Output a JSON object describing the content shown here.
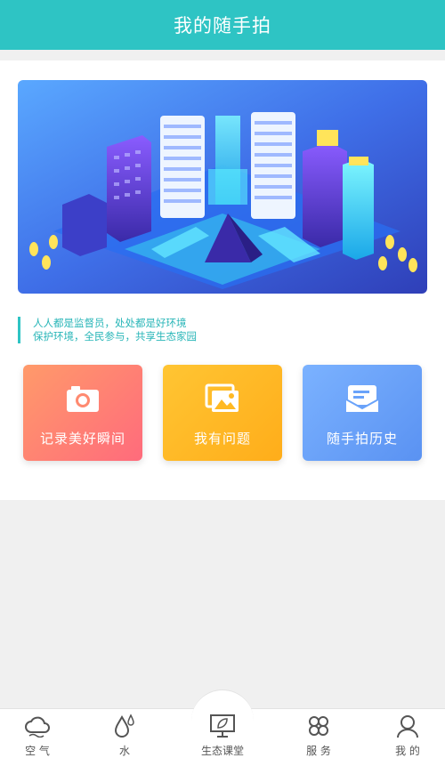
{
  "header": {
    "title": "我的随手拍"
  },
  "slogan": {
    "line1": "人人都是监督员，处处都是好环境",
    "line2": "保护环境，全民参与，共享生态家园"
  },
  "tiles": [
    {
      "label": "记录美好瞬间",
      "icon": "camera-icon",
      "color": "#ff7e74"
    },
    {
      "label": "我有问题",
      "icon": "image-icon",
      "color": "#ffb923"
    },
    {
      "label": "随手拍历史",
      "icon": "message-envelope-icon",
      "color": "#6aa3fa"
    }
  ],
  "tabbar": {
    "items": [
      {
        "label": "空 气",
        "icon": "cloud-icon"
      },
      {
        "label": "水",
        "icon": "water-drop-icon"
      },
      {
        "label": "生态课堂",
        "icon": "leaf-board-icon"
      },
      {
        "label": "服 务",
        "icon": "clover-icon"
      },
      {
        "label": "我 的",
        "icon": "user-icon"
      }
    ]
  },
  "colors": {
    "header": "#2ec4c4",
    "accent": "#29b6b8"
  }
}
